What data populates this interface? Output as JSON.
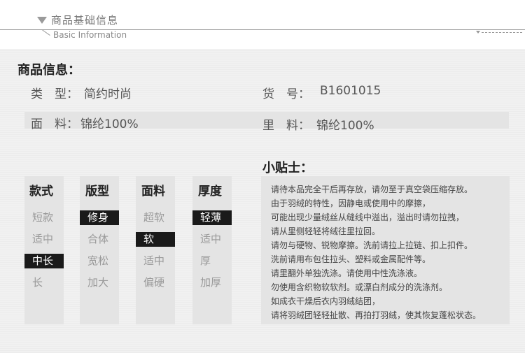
{
  "header": {
    "title_cn": "商品基础信息",
    "title_en": "Basic Information"
  },
  "info": {
    "section_title": "商品信息：",
    "type_label": "类　型：",
    "type_value": "简约时尚",
    "sku_label": "货　号：",
    "sku_value": "B1601015",
    "fabric_label": "面　料：",
    "fabric_value": "锦纶100%",
    "lining_label": "里　料：",
    "lining_value": "锦纶100%"
  },
  "attributes": [
    {
      "header": "款式",
      "options": [
        "短款",
        "适中",
        "中长",
        "长"
      ],
      "selected": "中长"
    },
    {
      "header": "版型",
      "options": [
        "修身",
        "合体",
        "宽松",
        "加大"
      ],
      "selected": "修身"
    },
    {
      "header": "面料",
      "options": [
        "超软",
        "软",
        "适中",
        "偏硬"
      ],
      "selected": "软"
    },
    {
      "header": "厚度",
      "options": [
        "轻薄",
        "适中",
        "厚",
        "加厚"
      ],
      "selected": "轻薄"
    }
  ],
  "tips": {
    "title": "小贴士：",
    "lines": [
      "请待本品完全干后再存放，请勿至于真空袋压缩存放。",
      "由于羽绒的特性，因静电或使用中的摩擦，",
      "可能出现少量绒丝从缝线中溢出，溢出时请勿拉拽，",
      "请从里侧轻轻将绒往里拉回。",
      "请勿与硬物、锐物摩擦。洗前请拉上拉链、扣上扣件。",
      "洗前请用布包住拉头、塑料或金属配件等。",
      "请里翻外单独洗涤。请使用中性洗涤液。",
      "勿使用含织物软软剂。或漂白剂成分的洗涤剂。",
      "如成衣干燥后衣内羽绒结团，",
      "请将羽绒团轻轻扯散、再拍打羽绒，使其恢复蓬松状态。"
    ]
  }
}
